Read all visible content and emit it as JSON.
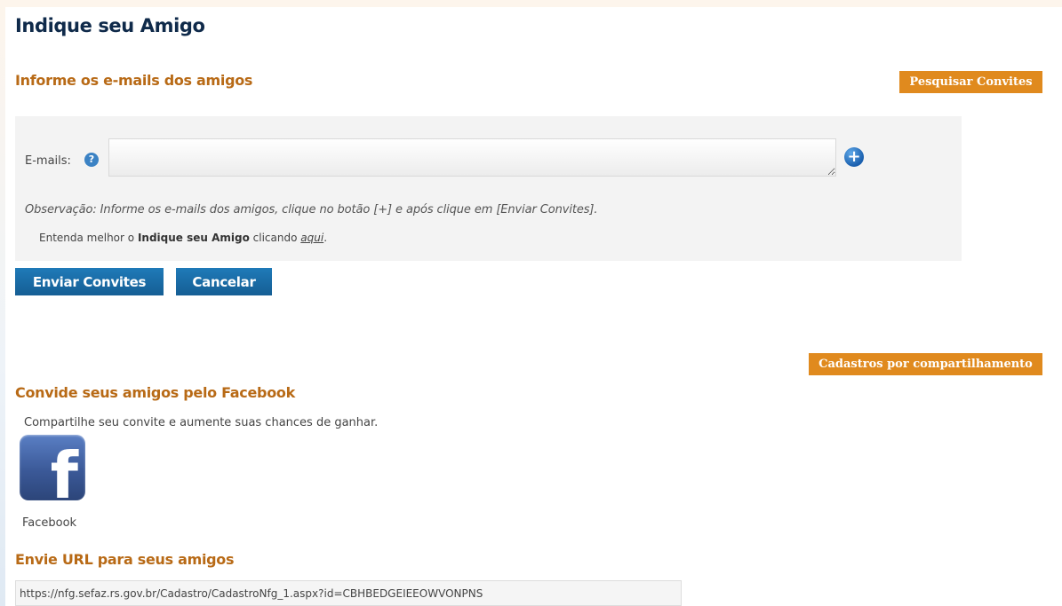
{
  "page": {
    "title": "Indique seu Amigo"
  },
  "invite_section": {
    "heading": "Informe os e-mails dos amigos",
    "search_invites_label": "Pesquisar Convites",
    "emails_label": "E-mails:",
    "emails_value": "",
    "help_icon": "question-circle-icon",
    "add_icon": "plus-circle-icon",
    "observation": "Observação: Informe os e-mails dos amigos, clique no botão [+] e após clique em [Enviar Convites].",
    "learn_more_prefix": "Entenda melhor o ",
    "learn_more_bold": "Indique seu Amigo",
    "learn_more_middle": " clicando ",
    "learn_more_link": "aqui",
    "learn_more_suffix": ".",
    "send_label": "Enviar Convites",
    "cancel_label": "Cancelar"
  },
  "sharing_registrations_label": "Cadastros por compartilhamento",
  "facebook_section": {
    "heading": "Convide seus amigos pelo Facebook",
    "description": "Compartilhe seu convite e aumente suas chances de ganhar.",
    "icon": "facebook-icon",
    "label": "Facebook"
  },
  "url_section": {
    "heading": "Envie URL para seus amigos",
    "url_value": "https://nfg.sefaz.rs.gov.br/Cadastro/CadastroNfg_1.aspx?id=CBHBEDGEIEEOWVONPNS"
  },
  "colors": {
    "title": "#0f2a4a",
    "section_heading": "#b86a16",
    "orange_button": "#e08a1e",
    "blue_button": "#1f7ab8",
    "panel_bg": "#f3f3f3",
    "facebook_blue": "#3b5998"
  }
}
